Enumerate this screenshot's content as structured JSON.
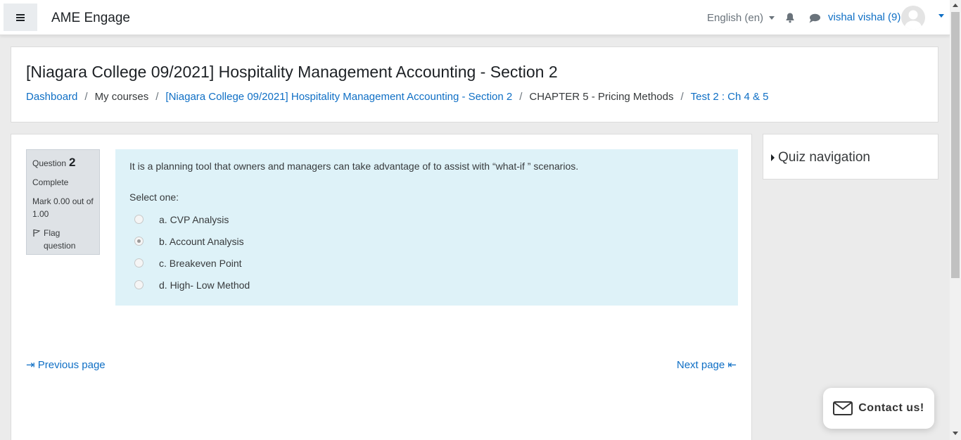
{
  "navbar": {
    "brand": "AME Engage",
    "language": "English (en)",
    "user_name": "vishal vishal (9)"
  },
  "header": {
    "title": "[Niagara College 09/2021] Hospitality Management Accounting - Section 2",
    "breadcrumb": [
      {
        "label": "Dashboard"
      },
      {
        "label": "My courses"
      },
      {
        "label": "[Niagara College 09/2021] Hospitality Management Accounting - Section 2"
      },
      {
        "label": "CHAPTER 5 - Pricing Methods"
      },
      {
        "label": "Test 2 : Ch 4 & 5"
      }
    ]
  },
  "question": {
    "label": "Question",
    "number": "2",
    "state": "Complete",
    "mark": "Mark 0.00 out of 1.00",
    "flag_label": "Flag question",
    "text": "It is a planning tool that owners and managers can take advantage of to assist with “what-if ” scenarios.",
    "prompt": "Select one:",
    "options": [
      {
        "label": "a. CVP Analysis",
        "selected": false
      },
      {
        "label": "b. Account Analysis",
        "selected": true
      },
      {
        "label": "c. Breakeven Point",
        "selected": false
      },
      {
        "label": "d. High- Low Method",
        "selected": false
      }
    ]
  },
  "pagination": {
    "previous": "Previous page",
    "next": "Next page"
  },
  "quiz_navigation": {
    "title": "Quiz navigation"
  },
  "contact": {
    "label": "Contact us!"
  },
  "colors": {
    "link": "#0f6fc5",
    "question_bg": "#def2f8",
    "info_bg": "#dee2e6"
  }
}
